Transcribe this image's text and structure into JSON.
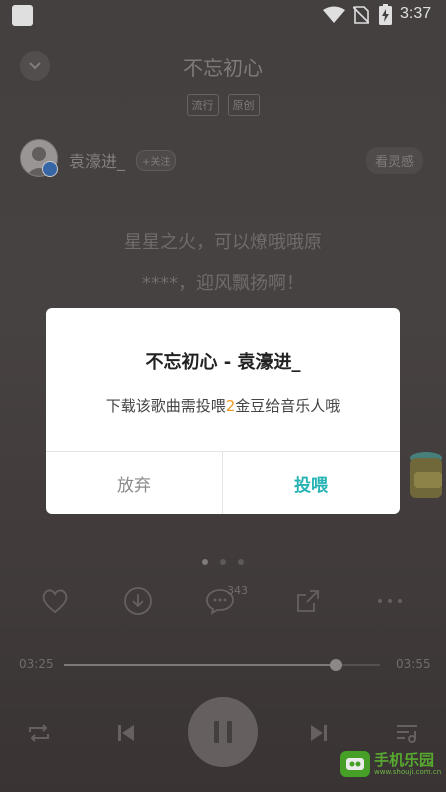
{
  "status_bar": {
    "time": "3:37"
  },
  "header": {
    "title": "不忘初心",
    "tags": [
      "流行",
      "原创"
    ]
  },
  "artist": {
    "name": "袁濠进_",
    "follow_label": "+关注",
    "inspire_label": "看灵感"
  },
  "lyrics": [
    "星星之火，可以燎哦哦原",
    "****，迎风飘扬啊！"
  ],
  "actions": {
    "comment_count": "343"
  },
  "progress": {
    "current": "03:25",
    "total": "03:55",
    "fraction": 0.86
  },
  "dialog": {
    "title": "不忘初心 - 袁濠进_",
    "message_prefix": "下载该歌曲需投喂",
    "message_number": "2",
    "message_suffix": "金豆给音乐人哦",
    "cancel_label": "放弃",
    "confirm_label": "投喂"
  },
  "watermark": {
    "text": "手机乐园",
    "sub": "www.shouji.com.cn"
  },
  "colors": {
    "accent": "#27b3b3",
    "highlight": "#f29a1f"
  }
}
